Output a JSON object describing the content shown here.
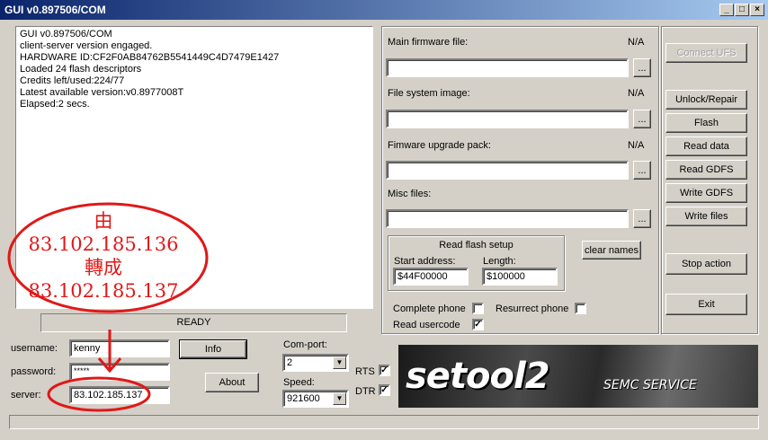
{
  "window": {
    "title": "GUI v0.897506/COM",
    "min": "_",
    "max": "□",
    "close": "×"
  },
  "log": {
    "lines": [
      "GUI v0.897506/COM",
      "client-server version engaged.",
      "HARDWARE ID:CF2F0AB84762B5541449C4D7479E1427",
      "Loaded 24 flash descriptors",
      "Credits left/used:224/77",
      "Latest available version:v0.8977008T",
      "Elapsed:2 secs."
    ]
  },
  "status": {
    "text": "READY"
  },
  "login": {
    "username_label": "username:",
    "username": "kenny",
    "password_label": "password:",
    "password": "*****",
    "server_label": "server:",
    "server": "83.102.185.137",
    "info_button": "Info",
    "about_button": "About"
  },
  "port": {
    "com_label": "Com-port:",
    "com": "2",
    "speed_label": "Speed:",
    "speed": "921600",
    "rts_label": "RTS",
    "dtr_label": "DTR",
    "check": "✓",
    "arrow": "▼"
  },
  "files": {
    "main_label": "Main firmware file:",
    "main_state": "N/A",
    "fs_label": "File system image:",
    "fs_state": "N/A",
    "fup_label": "Fimware upgrade pack:",
    "fup_state": "N/A",
    "misc_label": "Misc files:",
    "browse": "..."
  },
  "readflash": {
    "title": "Read flash setup",
    "start_label": "Start address:",
    "start": "$44F00000",
    "length_label": "Length:",
    "length": "$100000",
    "clear_names": "clear names",
    "complete_phone": "Complete phone",
    "resurrect_phone": "Resurrect phone",
    "read_usercode": "Read usercode"
  },
  "actions": {
    "connect": "Connect UFS",
    "unlock": "Unlock/Repair",
    "flash": "Flash",
    "read_data": "Read data",
    "read_gdfs": "Read GDFS",
    "write_gdfs": "Write GDFS",
    "write_files": "Write files",
    "stop": "Stop action",
    "exit": "Exit"
  },
  "banner": {
    "logo": "setool2",
    "subtitle": "SEMC SERVICE"
  },
  "annotation": {
    "line1": "由",
    "line2": "83.102.185.136",
    "line3": "轉成",
    "line4": "83.102.185.137"
  },
  "colors": {
    "annotation": "#e01818",
    "titlebar": "#0a246a"
  }
}
